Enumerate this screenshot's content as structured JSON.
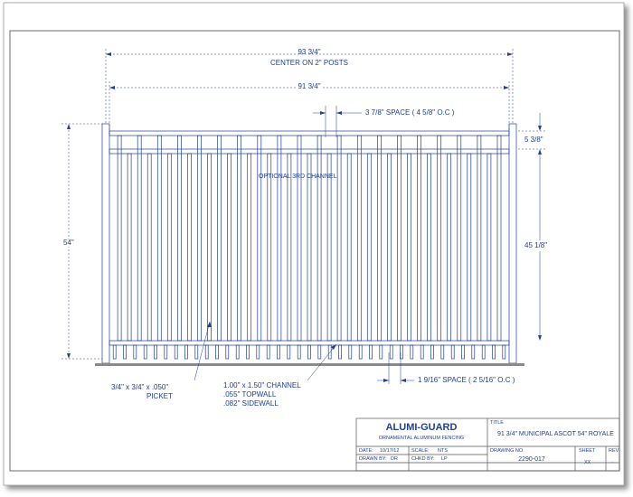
{
  "drawing": {
    "overall_width": "93 3/4\"",
    "overall_width_note": "CENTER ON 2\" POSTS",
    "panel_width": "91 3/4\"",
    "top_space": "3 7/8\" SPACE ( 4 5/8\" O.C )",
    "top_height": "5 3/8\"",
    "optional_channel": "OPTIONAL 3RD CHANNEL",
    "overall_height": "54\"",
    "picket_height": "45 1/8\"",
    "bottom_space": "1 9/16\" SPACE ( 2 5/16\" O.C )",
    "picket_spec": [
      "3/4\" x 3/4\" x .050\"",
      "PICKET"
    ],
    "channel_spec": [
      "1.00\" x 1.50\" CHANNEL",
      ".055\" TOPWALL",
      ".082\" SIDEWALL"
    ]
  },
  "title_block": {
    "company": "ALUMI-GUARD",
    "subtitle": "ORNAMENTAL ALUMINUM FENCING",
    "title_label": "TITLE",
    "title": "91 3/4\" MUNICIPAL ASCOT 54\" ROYALE",
    "date_label": "DATE:",
    "date": "10/17/12",
    "scale_label": "SCALE:",
    "scale": "NTS",
    "drawing_no_label": "DRAWING NO",
    "drawing_no": "2290-017",
    "sheet_label": "SHEET",
    "sheet": "XX",
    "rev_label": "REV",
    "rev": "--",
    "drawn_label": "DRAWN BY:",
    "drawn": "DR",
    "chkd_label": "CHKD BY:",
    "chkd": "LP"
  },
  "colors": {
    "line": "#1f3f95",
    "ground": "#8a8a8a",
    "border": "#555555"
  }
}
